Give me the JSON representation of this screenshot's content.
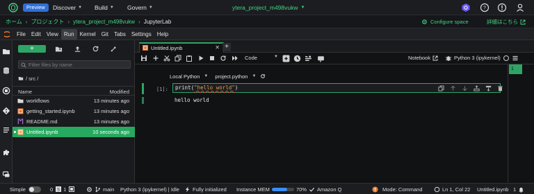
{
  "topnav": {
    "preview": "Preview",
    "menus": [
      "Discover",
      "Build",
      "Govern"
    ],
    "project": "ytera_project_m498vukw"
  },
  "crumbs": {
    "home": "ホーム",
    "project": "プロジェクト",
    "project_name": "ytera_project_m498vukw",
    "current": "JupyterLab",
    "configure": "Configure space",
    "details": "詳細はこちら"
  },
  "menubar": [
    "File",
    "Edit",
    "View",
    "Run",
    "Kernel",
    "Git",
    "Tabs",
    "Settings",
    "Help"
  ],
  "menubar_active": "Run",
  "filebrowser": {
    "new_label": "+",
    "filter_placeholder": "Filter files by name",
    "path": "/ src /",
    "col_name": "Name",
    "col_modified": "Modified",
    "files": [
      {
        "name": "workflows",
        "modified": "13 minutes ago",
        "icon": "folder-icon"
      },
      {
        "name": "getting_started.ipynb",
        "modified": "13 minutes ago",
        "icon": "notebook-icon"
      },
      {
        "name": "README.md",
        "modified": "13 minutes ago",
        "icon": "markdown-icon"
      },
      {
        "name": "Untitled.ipynb",
        "modified": "10 seconds ago",
        "icon": "notebook-icon"
      }
    ]
  },
  "editor": {
    "tab_name": "Untitled.ipynb",
    "cell_type": "Code",
    "notebook_label": "Notebook",
    "kernel_label": "Python 3 (ipykernel)",
    "env": "Local Python",
    "project_file": "project.python",
    "prompt": "[1]:",
    "code_fn": "print",
    "code_open": "(",
    "code_str": "\"hello world\"",
    "code_close": ")",
    "output": "hello world",
    "minimap_label": "1"
  },
  "statusbar": {
    "mode_label": "Simple",
    "count_a": "0",
    "count_b": "1",
    "branch": "main",
    "kernel_status": "Python 3 (ipykernel) | Idle",
    "init": "Fully initialized",
    "mem_label": "Instance MEM",
    "mem_value": "70%",
    "mem_fraction": 0.7,
    "amazon_q": "Amazon Q",
    "mode": "Mode: Command",
    "cursor": "Ln 1, Col 22",
    "file": "Untitled.ipynb",
    "notif": "1"
  },
  "colors": {
    "accent": "#2ea564",
    "link": "#45d483",
    "preview": "#2e6fd8"
  }
}
